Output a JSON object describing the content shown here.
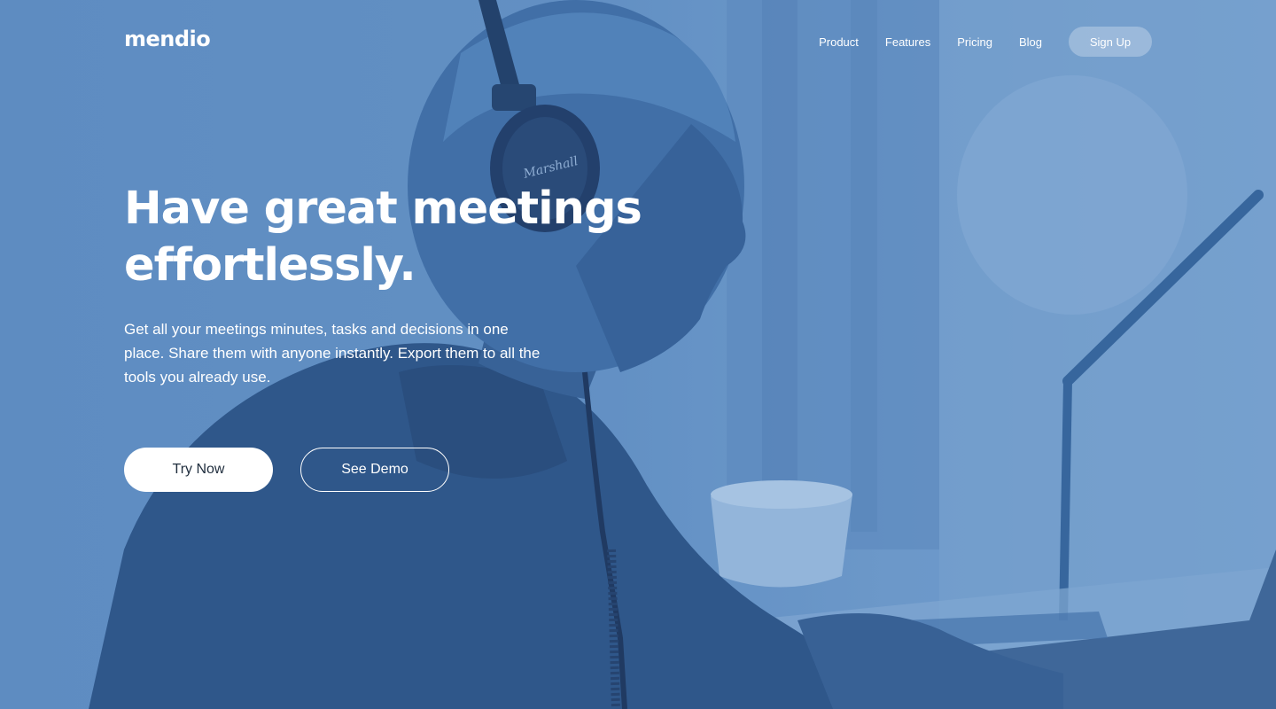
{
  "brand": {
    "name": "mendio"
  },
  "nav": {
    "links": [
      "Product",
      "Features",
      "Pricing",
      "Blog"
    ],
    "signup_label": "Sign Up"
  },
  "hero": {
    "headline_line1": "Have great meetings",
    "headline_line2": "effortlessly.",
    "subtext": "Get all your meetings minutes, tasks and decisions in one place. Share them with anyone instantly. Export them to all the tools you already use.",
    "primary_cta": "Try Now",
    "secondary_cta": "See Demo"
  },
  "colors": {
    "overlay_blue": "#5f8dc1",
    "button_text": "#1f2d3d",
    "white": "#ffffff"
  },
  "icons": {
    "headphone_brand_text": "Marshall"
  }
}
